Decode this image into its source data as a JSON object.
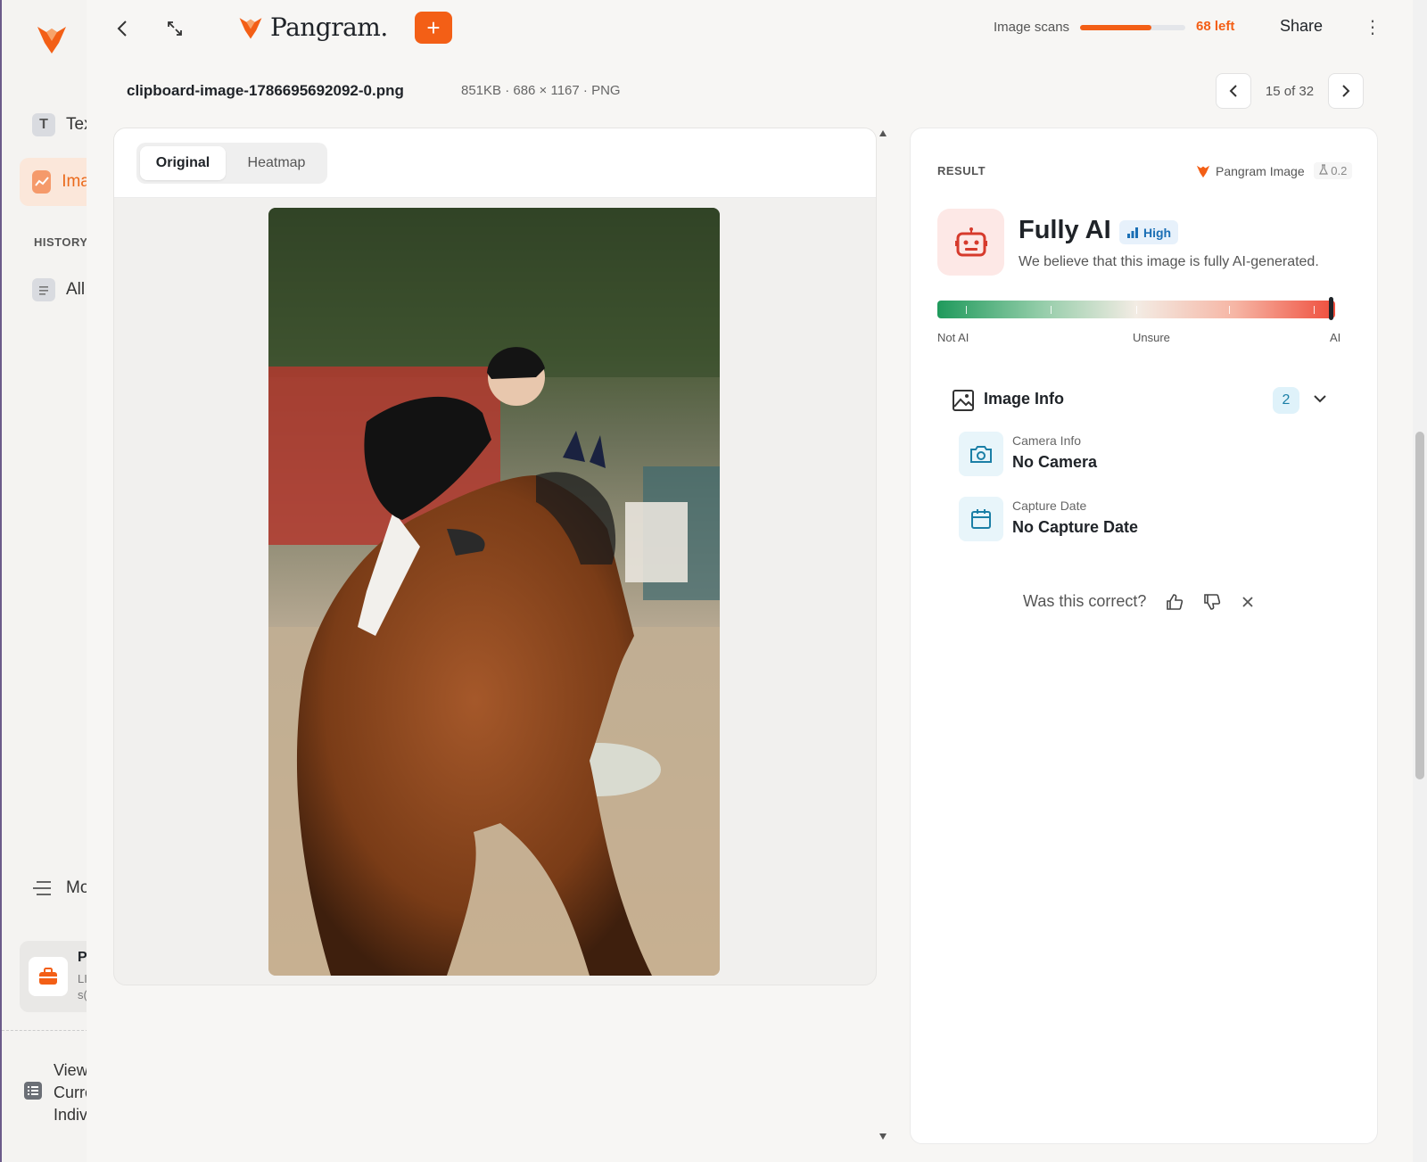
{
  "sidebar": {
    "items": [
      {
        "label": "Text",
        "icon": "text-icon"
      },
      {
        "label": "Image",
        "icon": "image-icon"
      },
      {
        "label": "All",
        "icon": "document-icon"
      }
    ],
    "history_label": "HISTORY",
    "more_label": "More",
    "card": {
      "title": "P",
      "subtitle_1": "LI",
      "subtitle_2": "s("
    },
    "view": {
      "line1": "View",
      "line2": "Curre",
      "line3": "Indiv"
    }
  },
  "topbar": {
    "brand": "Pangram.",
    "add_label": "+",
    "scans_label": "Image scans",
    "scans_left": "68 left",
    "scans_fraction": 0.68,
    "share_label": "Share",
    "more_label": "⋮"
  },
  "file": {
    "name": "clipboard-image-1786695692092-0.png",
    "meta": "851KB · 686 × 1167 · PNG"
  },
  "pager": {
    "text": "15 of 32"
  },
  "viewer": {
    "tabs": [
      {
        "label": "Original",
        "active": true
      },
      {
        "label": "Heatmap",
        "active": false
      }
    ]
  },
  "result": {
    "label": "RESULT",
    "model": "Pangram Image",
    "version": "0.2",
    "verdict": "Fully AI",
    "confidence": "High",
    "description": "We believe that this image is fully AI-generated.",
    "gauge": {
      "left": "Not AI",
      "mid": "Unsure",
      "right": "AI",
      "position": 0.99
    },
    "info": {
      "title": "Image Info",
      "count": "2",
      "rows": [
        {
          "key": "Camera Info",
          "value": "No Camera"
        },
        {
          "key": "Capture Date",
          "value": "No Capture Date"
        }
      ]
    },
    "feedback": "Was this correct?"
  },
  "colors": {
    "accent": "#f35f16",
    "ai_red": "#ef4d3c",
    "not_ai_green": "#1f9a5c",
    "badge_blue": "#1b6fb5"
  }
}
